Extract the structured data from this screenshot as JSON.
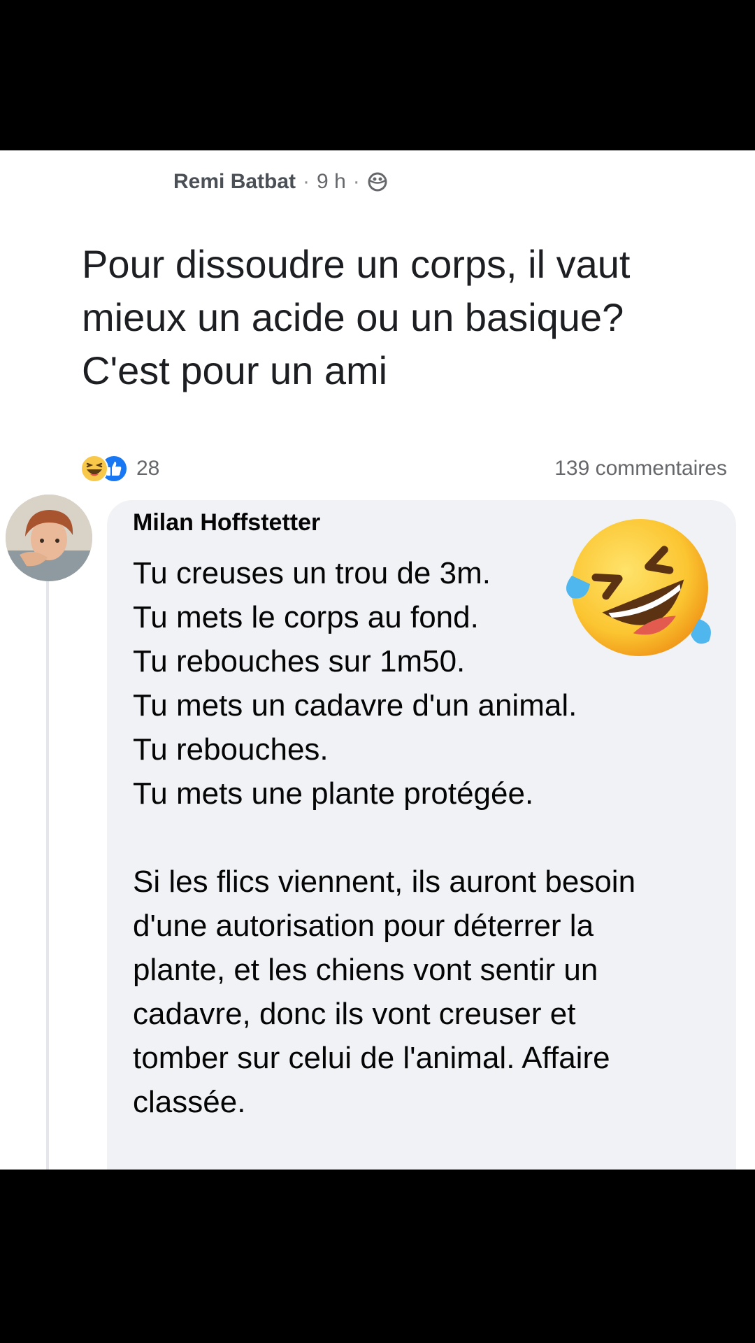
{
  "post": {
    "author": "Remi Batbat",
    "separator": "·",
    "time": "9 h",
    "audience_icon": "globe-icon",
    "text_lines": [
      "Pour dissoudre un corps, il vaut",
      "mieux un acide ou un basique?",
      "C'est pour un ami"
    ],
    "reactions": {
      "icons": [
        "haha-icon",
        "like-icon"
      ],
      "count": "28"
    },
    "comments_count": "139 commentaires"
  },
  "comment": {
    "author": "Milan Hoffstetter",
    "lines": [
      "Tu creuses un trou de 3m.",
      "Tu mets le corps au fond.",
      "Tu rebouches sur 1m50.",
      "Tu mets un cadavre d'un animal.",
      "Tu rebouches.",
      "Tu mets une plante protégée.",
      "",
      "Si les flics viennent, ils auront besoin",
      "d'une autorisation pour déterrer la",
      "plante, et les chiens vont sentir un",
      "cadavre, donc ils vont creuser et",
      "tomber sur celui de l'animal. Affaire",
      "classée."
    ]
  },
  "overlay": {
    "emoji": "rolling-on-floor-laughing-emoji"
  },
  "colors": {
    "background": "#000000",
    "card": "#ffffff",
    "bubble": "#f0f2f5",
    "like_blue": "#1877f2",
    "emoji_yellow": "#fdd53c"
  }
}
